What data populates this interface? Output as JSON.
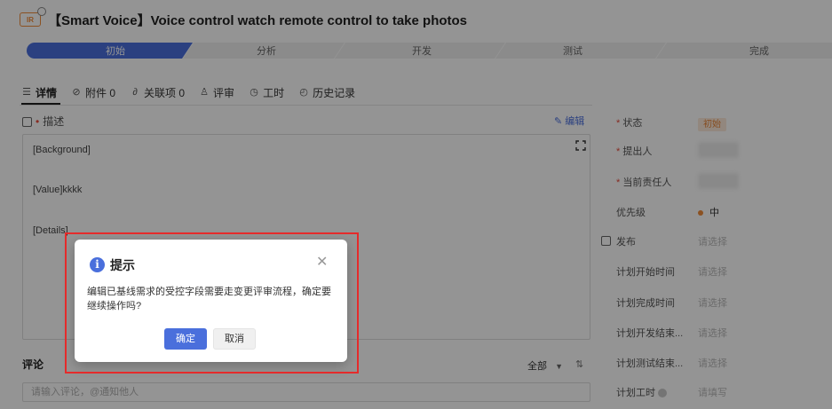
{
  "header": {
    "badge": "IR",
    "title": "【Smart Voice】Voice control watch remote control to take photos"
  },
  "stages": [
    "初始",
    "分析",
    "开发",
    "测试",
    "完成"
  ],
  "tabs": [
    {
      "label": "详情",
      "icon": "detail-icon"
    },
    {
      "label": "附件 0",
      "icon": "paperclip-icon"
    },
    {
      "label": "关联项 0",
      "icon": "link-icon"
    },
    {
      "label": "评审",
      "icon": "review-icon"
    },
    {
      "label": "工时",
      "icon": "clock-icon"
    },
    {
      "label": "历史记录",
      "icon": "history-icon"
    }
  ],
  "description": {
    "label": "描述",
    "edit_label": "编辑",
    "lines": [
      "[Background]",
      "[Value]kkkk",
      "[Details]"
    ]
  },
  "comment": {
    "label": "评论",
    "filter_label": "全部",
    "placeholder": "请输入评论，@通知他人"
  },
  "fields": [
    {
      "label": "状态",
      "value": "初始"
    },
    {
      "label": "提出人",
      "value": ""
    },
    {
      "label": "当前责任人",
      "value": ""
    },
    {
      "label": "优先级",
      "value": "中"
    },
    {
      "label": "发布",
      "value": "请选择"
    },
    {
      "label": "计划开始时间",
      "value": "请选择"
    },
    {
      "label": "计划完成时间",
      "value": "请选择"
    },
    {
      "label": "计划开发结束...",
      "value": "请选择"
    },
    {
      "label": "计划测试结束...",
      "value": "请选择"
    },
    {
      "label": "计划工时",
      "value": "请填写"
    }
  ],
  "dialog": {
    "title": "提示",
    "message": "编辑已基线需求的受控字段需要走变更评审流程，确定要继续操作吗?",
    "ok_label": "确定",
    "cancel_label": "取消"
  },
  "colors": {
    "accent": "#4a6fdc",
    "status_orange": "#e8863a",
    "highlight_red": "#e52b2b"
  }
}
